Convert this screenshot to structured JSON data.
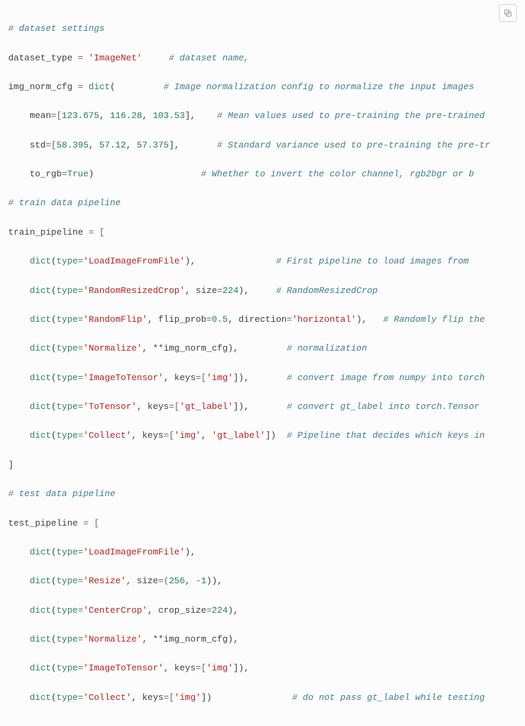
{
  "copy_button_title": "Copy",
  "code": {
    "l01": "# dataset settings",
    "l02a": "dataset_type ",
    "l02b": "= ",
    "l02c": "'ImageNet'",
    "l02d": "     ",
    "l02e": "# dataset name,",
    "l03a": "img_norm_cfg ",
    "l03b": "= ",
    "l03c": "dict",
    "l03d": "(         ",
    "l03e": "# Image normalization config to normalize the input images",
    "l04a": "    mean",
    "l04b": "=[",
    "l04c": "123.675",
    "l04d": ", ",
    "l04e": "116.28",
    "l04f": ", ",
    "l04g": "103.53",
    "l04h": "],    ",
    "l04i": "# Mean values used to pre-training the pre-trained",
    "l05a": "    std",
    "l05b": "=[",
    "l05c": "58.395",
    "l05d": ", ",
    "l05e": "57.12",
    "l05f": ", ",
    "l05g": "57.375",
    "l05h": "],       ",
    "l05i": "# Standard variance used to pre-training the pre-tr",
    "l06a": "    to_rgb",
    "l06b": "=",
    "l06c": "True",
    "l06d": ")                    ",
    "l06e": "# Whether to invert the color channel, rgb2bgr or b",
    "l07": "# train data pipeline",
    "l08a": "train_pipeline ",
    "l08b": "= [",
    "l09a": "    ",
    "l09b": "dict",
    "l09c": "(",
    "l09d": "type",
    "l09e": "=",
    "l09f": "'LoadImageFromFile'",
    "l09g": "),               ",
    "l09h": "# First pipeline to load images from",
    "l10a": "    ",
    "l10b": "dict",
    "l10c": "(",
    "l10d": "type",
    "l10e": "=",
    "l10f": "'RandomResizedCrop'",
    "l10g": ", size",
    "l10h": "=",
    "l10i": "224",
    "l10j": "),     ",
    "l10k": "# RandomResizedCrop",
    "l11a": "    ",
    "l11b": "dict",
    "l11c": "(",
    "l11d": "type",
    "l11e": "=",
    "l11f": "'RandomFlip'",
    "l11g": ", flip_prob",
    "l11h": "=",
    "l11i": "0.5",
    "l11j": ", direction",
    "l11k": "=",
    "l11l": "'horizontal'",
    "l11m": "),   ",
    "l11n": "# Randomly flip the",
    "l12a": "    ",
    "l12b": "dict",
    "l12c": "(",
    "l12d": "type",
    "l12e": "=",
    "l12f": "'Normalize'",
    "l12g": ", **img_norm_cfg),         ",
    "l12h": "# normalization",
    "l13a": "    ",
    "l13b": "dict",
    "l13c": "(",
    "l13d": "type",
    "l13e": "=",
    "l13f": "'ImageToTensor'",
    "l13g": ", keys",
    "l13h": "=[",
    "l13i": "'img'",
    "l13j": "]),       ",
    "l13k": "# convert image from numpy into torch",
    "l14a": "    ",
    "l14b": "dict",
    "l14c": "(",
    "l14d": "type",
    "l14e": "=",
    "l14f": "'ToTensor'",
    "l14g": ", keys",
    "l14h": "=[",
    "l14i": "'gt_label'",
    "l14j": "]),       ",
    "l14k": "# convert gt_label into torch.Tensor",
    "l15a": "    ",
    "l15b": "dict",
    "l15c": "(",
    "l15d": "type",
    "l15e": "=",
    "l15f": "'Collect'",
    "l15g": ", keys",
    "l15h": "=[",
    "l15i": "'img'",
    "l15j": ", ",
    "l15k": "'gt_label'",
    "l15l": "])  ",
    "l15m": "# Pipeline that decides which keys in",
    "l16": "]",
    "l17": "# test data pipeline",
    "l18a": "test_pipeline ",
    "l18b": "= [",
    "l19a": "    ",
    "l19b": "dict",
    "l19c": "(",
    "l19d": "type",
    "l19e": "=",
    "l19f": "'LoadImageFromFile'",
    "l19g": "),",
    "l20a": "    ",
    "l20b": "dict",
    "l20c": "(",
    "l20d": "type",
    "l20e": "=",
    "l20f": "'Resize'",
    "l20g": ", size",
    "l20h": "=(",
    "l20i": "256",
    "l20j": ", ",
    "l20k": "-",
    "l20l": "1",
    "l20m": ")),",
    "l21a": "    ",
    "l21b": "dict",
    "l21c": "(",
    "l21d": "type",
    "l21e": "=",
    "l21f": "'CenterCrop'",
    "l21g": ", crop_size",
    "l21h": "=",
    "l21i": "224",
    "l21j": "),",
    "l22a": "    ",
    "l22b": "dict",
    "l22c": "(",
    "l22d": "type",
    "l22e": "=",
    "l22f": "'Normalize'",
    "l22g": ", **img_norm_cfg),",
    "l23a": "    ",
    "l23b": "dict",
    "l23c": "(",
    "l23d": "type",
    "l23e": "=",
    "l23f": "'ImageToTensor'",
    "l23g": ", keys",
    "l23h": "=[",
    "l23i": "'img'",
    "l23j": "]),",
    "l24a": "    ",
    "l24b": "dict",
    "l24c": "(",
    "l24d": "type",
    "l24e": "=",
    "l24f": "'Collect'",
    "l24g": ", keys",
    "l24h": "=[",
    "l24i": "'img'",
    "l24j": "])               ",
    "l24k": "# do not pass gt_label while testing"
  }
}
